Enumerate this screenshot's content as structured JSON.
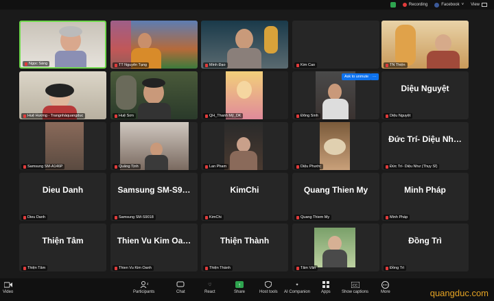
{
  "topbar": {
    "recording": "Recording",
    "facebook": "Facebook",
    "view": "View"
  },
  "tiles": [
    {
      "name": "Ngọc Sáng",
      "big": ""
    },
    {
      "name": "TT Nguyên Tạng",
      "big": ""
    },
    {
      "name": "Minh Đạo",
      "big": ""
    },
    {
      "name": "Kim Cao",
      "big": ""
    },
    {
      "name": "TN Thiện",
      "big": ""
    },
    {
      "name": "Huệ Hương - Trangnhàquangduc",
      "big": ""
    },
    {
      "name": "Huệ Sơn",
      "big": ""
    },
    {
      "name": "QH_Thanh Mỹ_DK",
      "big": ""
    },
    {
      "name": "Đông Sinh",
      "big": ""
    },
    {
      "name": "Diệu Nguyệt",
      "big": "Diệu Nguyệt"
    },
    {
      "name": "Samsung SM-A146P",
      "big": ""
    },
    {
      "name": "Quảng Tịnh",
      "big": ""
    },
    {
      "name": "Lan Pham",
      "big": ""
    },
    {
      "name": "Diệu Phước",
      "big": ""
    },
    {
      "name": "Đức Trí- Diệu Như (Thụy Sĩ)",
      "big": "Đức Trí- Diệu Nh…"
    },
    {
      "name": "Dieu Danh",
      "big": "Dieu Danh"
    },
    {
      "name": "Samsung SM-S9018",
      "big": "Samsung SM-S9…"
    },
    {
      "name": "KimChi",
      "big": "KimChi"
    },
    {
      "name": "Quang Thiem My",
      "big": "Quang Thien My"
    },
    {
      "name": "Minh Pháp",
      "big": "Minh Pháp"
    },
    {
      "name": "Thiện Tâm",
      "big": "Thiện Tâm"
    },
    {
      "name": "Thien Vu Kim Oanh",
      "big": "Thien Vu Kim Oa…"
    },
    {
      "name": "Thiện Thành",
      "big": "Thiện Thành"
    },
    {
      "name": "Tâm Vân",
      "big": ""
    },
    {
      "name": "Đồng Trì",
      "big": "Đồng Trì"
    }
  ],
  "overlay": {
    "ask": "Ask to unmute",
    "more": "···"
  },
  "toolbar": {
    "video": "Video",
    "participants": "Participants",
    "participants_count": "45",
    "chat": "Chat",
    "react": "React",
    "share": "Share",
    "host_tools": "Host tools",
    "ai": "AI Companion",
    "apps": "Apps",
    "captions": "Show captions",
    "more": "More"
  },
  "watermark": "quangduc.com",
  "colors": {
    "active_border": "#6fd94c",
    "share": "#2ea44f",
    "muted": "#e23b3b",
    "watermark": "#e6a423"
  }
}
